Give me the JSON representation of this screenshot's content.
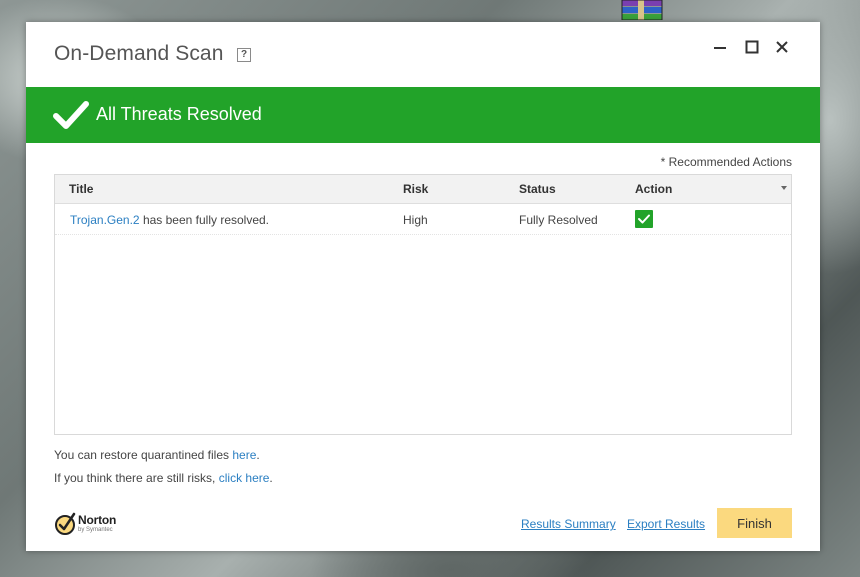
{
  "window": {
    "title": "On-Demand Scan",
    "help_glyph": "?"
  },
  "banner": {
    "text": "All Threats Resolved",
    "color": "#22a329"
  },
  "recommended_note": "* Recommended Actions",
  "table": {
    "columns": [
      "Title",
      "Risk",
      "Status",
      "Action"
    ],
    "rows": [
      {
        "threat_name": "Trojan.Gen.2",
        "title_suffix": "has been fully resolved.",
        "risk": "High",
        "status": "Fully Resolved",
        "action_icon": "check-icon"
      }
    ]
  },
  "footer": {
    "restore_text": "You can restore quarantined files",
    "restore_link": "here",
    "restore_end": ".",
    "risk_text": "If you think there are still risks,",
    "risk_link": "click here",
    "risk_end": "."
  },
  "brand": {
    "name": "Norton",
    "sub": "by Symantec",
    "accent": "#fbd97f"
  },
  "actions": {
    "results_summary": "Results Summary",
    "export_results": "Export Results",
    "finish": "Finish"
  },
  "icons": {
    "minimize": "minimize-icon",
    "maximize": "maximize-icon",
    "close": "close-icon",
    "desktop": "winrar-archive-icon"
  }
}
